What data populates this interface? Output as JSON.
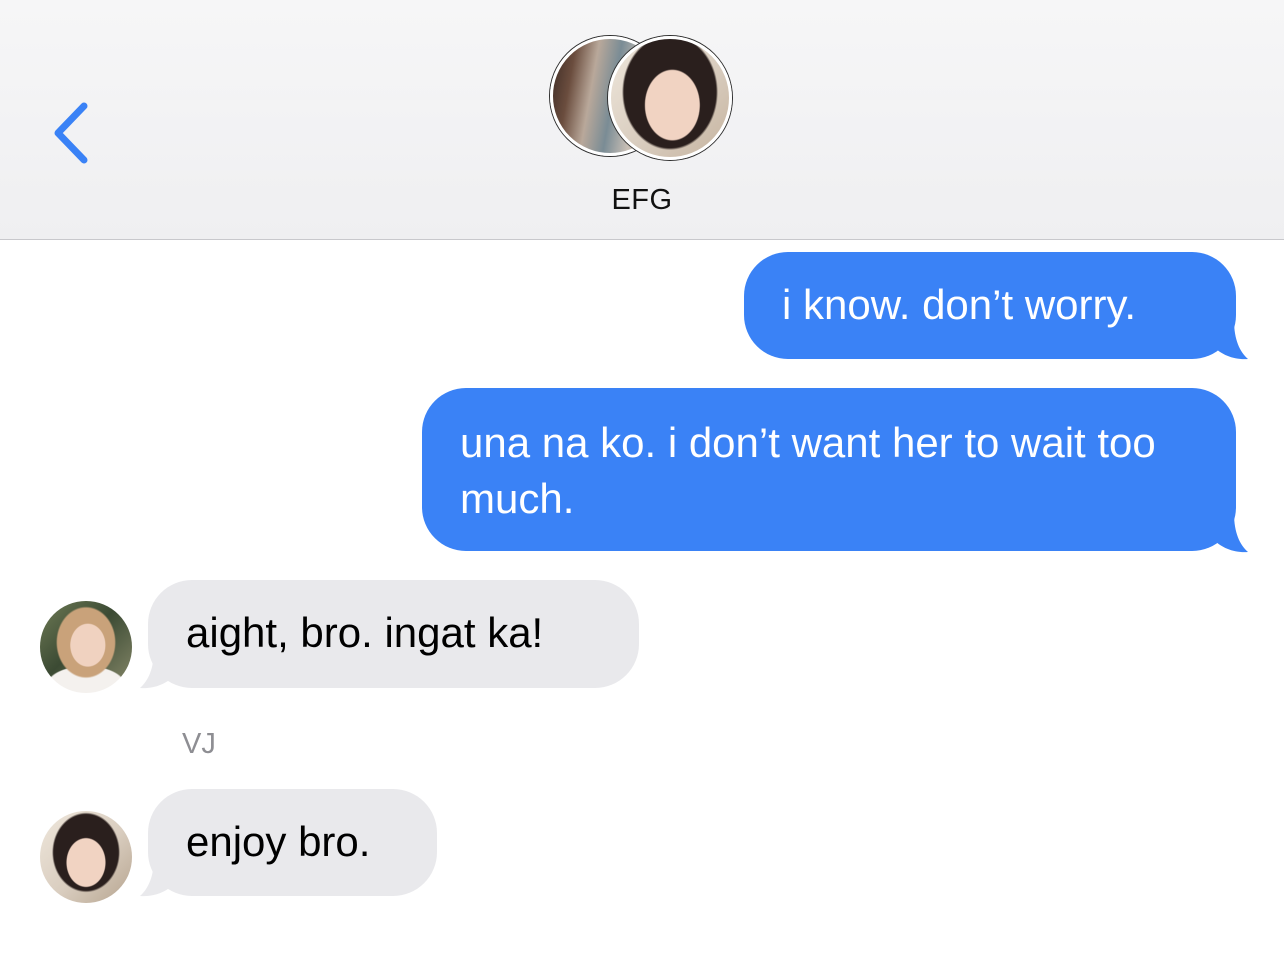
{
  "header": {
    "back_icon": "chevron-left-icon",
    "group_name": "EFG",
    "accent_color": "#3a82f6"
  },
  "messages": [
    {
      "direction": "sent",
      "text": "i know. don’t worry."
    },
    {
      "direction": "sent",
      "text": "una na ko. i don’t want her to wait too much."
    },
    {
      "direction": "received",
      "sender": "",
      "text": "aight, bro. ingat ka!"
    },
    {
      "direction": "received",
      "sender": "VJ",
      "text": "enjoy bro."
    }
  ],
  "colors": {
    "sent_bubble": "#3a82f6",
    "received_bubble": "#e9e9ec",
    "sender_name": "#8e8e93"
  }
}
